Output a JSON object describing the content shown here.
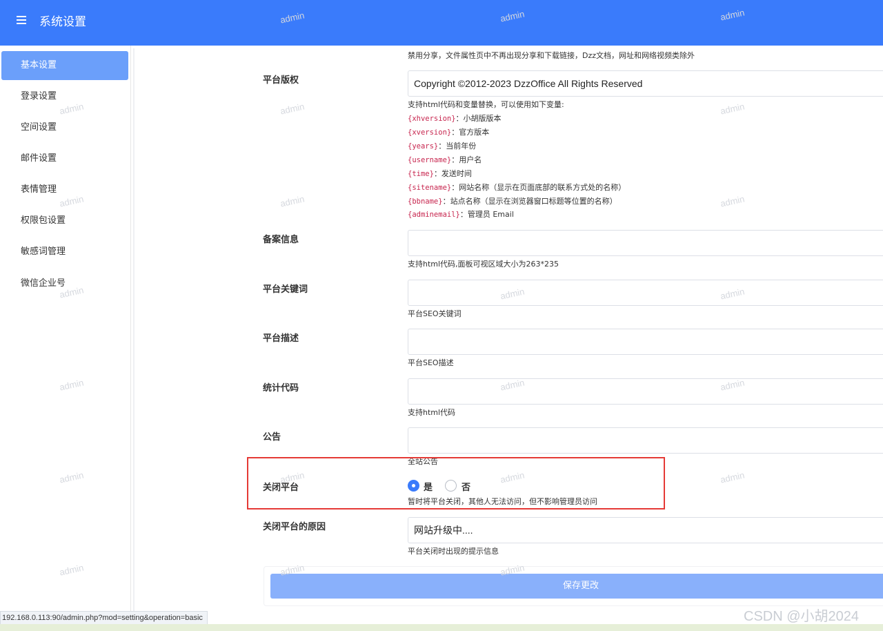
{
  "header": {
    "title": "系统设置"
  },
  "sidebar": {
    "items": [
      {
        "label": "基本设置"
      },
      {
        "label": "登录设置"
      },
      {
        "label": "空间设置"
      },
      {
        "label": "邮件设置"
      },
      {
        "label": "表情管理"
      },
      {
        "label": "权限包设置"
      },
      {
        "label": "敏感词管理"
      },
      {
        "label": "微信企业号"
      }
    ]
  },
  "form": {
    "share_note": "禁用分享，文件属性页中不再出现分享和下载链接，Dzz文档，网址和网络视频类除外",
    "copyright": {
      "label": "平台版权",
      "value": "Copyright ©2012-2023 DzzOffice  All Rights Reserved",
      "help": "支持html代码和变量替换，可以使用如下变量:",
      "vars": [
        {
          "code": "{xhversion}",
          "desc": "：小胡版版本"
        },
        {
          "code": "{xversion}",
          "desc": "：官方版本"
        },
        {
          "code": "{years}",
          "desc": "：当前年份"
        },
        {
          "code": "{username}",
          "desc": "：用户名"
        },
        {
          "code": "{time}",
          "desc": "：发送时间"
        },
        {
          "code": "{sitename}",
          "desc": "：网站名称（显示在页面底部的联系方式处的名称）"
        },
        {
          "code": "{bbname}",
          "desc": "：站点名称（显示在浏览器窗口标题等位置的名称）"
        },
        {
          "code": "{adminemail}",
          "desc": "：管理员 Email"
        }
      ]
    },
    "icp": {
      "label": "备案信息",
      "value": "",
      "help": "支持html代码,面板可视区域大小为263*235"
    },
    "keywords": {
      "label": "平台关键词",
      "value": "",
      "help": "平台SEO关键词"
    },
    "description": {
      "label": "平台描述",
      "value": "",
      "help": "平台SEO描述"
    },
    "stats": {
      "label": "统计代码",
      "value": "",
      "help": "支持html代码"
    },
    "notice": {
      "label": "公告",
      "value": "",
      "help": "全站公告"
    },
    "close_site": {
      "label": "关闭平台",
      "options": [
        "是",
        "否"
      ],
      "selected": "是",
      "help": "暂时将平台关闭，其他人无法访问，但不影响管理员访问"
    },
    "close_reason": {
      "label": "关闭平台的原因",
      "value": "网站升级中....",
      "help": "平台关闭时出现的提示信息"
    },
    "save_label": "保存更改"
  },
  "statusbar": {
    "url": "192.168.0.113:90/admin.php?mod=setting&operation=basic"
  },
  "watermark": {
    "text": "admin",
    "csdn": "CSDN @小胡2024"
  },
  "colors": {
    "primary": "#3a7bfb",
    "active_nav": "#6b9ffa",
    "save_button": "#89b0fb",
    "highlight": "#e53935",
    "var_code": "#c7254e"
  }
}
